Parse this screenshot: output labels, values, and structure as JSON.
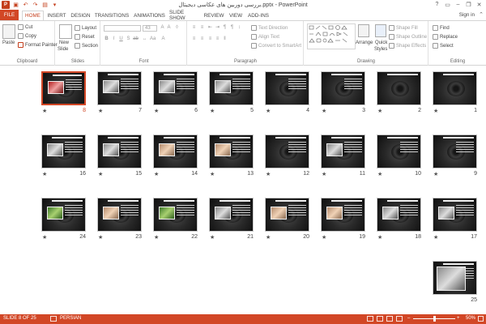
{
  "titlebar": {
    "title": "بررسی دوربین های عکاسی دیجیتال.pptx - PowerPoint",
    "app_icon": "P",
    "qat": [
      {
        "name": "save-icon",
        "glyph": "▣"
      },
      {
        "name": "undo-icon",
        "glyph": "↶"
      },
      {
        "name": "redo-icon",
        "glyph": "↷"
      },
      {
        "name": "start-slideshow-icon",
        "glyph": "▤"
      },
      {
        "name": "customize-qat-icon",
        "glyph": "▾"
      }
    ],
    "window_controls": [
      {
        "name": "help-icon",
        "glyph": "?"
      },
      {
        "name": "ribbon-display-icon",
        "glyph": "▭"
      },
      {
        "name": "minimize-icon",
        "glyph": "–"
      },
      {
        "name": "restore-icon",
        "glyph": "❐"
      },
      {
        "name": "close-icon",
        "glyph": "✕"
      }
    ]
  },
  "tabs": [
    "FILE",
    "HOME",
    "INSERT",
    "DESIGN",
    "TRANSITIONS",
    "ANIMATIONS",
    "SLIDE SHOW",
    "REVIEW",
    "VIEW",
    "ADD-INS"
  ],
  "active_tab": "HOME",
  "signin": "Sign in",
  "ribbon": {
    "clipboard": {
      "label": "Clipboard",
      "paste": "Paste",
      "cut": "Cut",
      "copy": "Copy",
      "format_painter": "Format Painter"
    },
    "slides": {
      "label": "Slides",
      "new_slide": "New",
      "new_slide_2": "Slide",
      "layout": "Layout",
      "reset": "Reset",
      "section": "Section"
    },
    "font": {
      "label": "Font",
      "font_size": "43"
    },
    "paragraph": {
      "label": "Paragraph",
      "text_direction": "Text Direction",
      "align_text": "Align Text",
      "convert_smartart": "Convert to SmartArt"
    },
    "drawing": {
      "label": "Drawing",
      "arrange": "Arrange",
      "quick_styles": "Quick",
      "quick_styles_2": "Styles",
      "shape_fill": "Shape Fill",
      "shape_outline": "Shape Outline",
      "shape_effects": "Shape Effects"
    },
    "editing": {
      "label": "Editing",
      "find": "Find",
      "replace": "Replace",
      "select": "Select"
    }
  },
  "slides": [
    {
      "number": "1",
      "style": "title"
    },
    {
      "number": "2",
      "style": "title"
    },
    {
      "number": "3",
      "style": "text"
    },
    {
      "number": "4",
      "style": "text"
    },
    {
      "number": "5",
      "style": "camera-pic"
    },
    {
      "number": "6",
      "style": "camera-pic"
    },
    {
      "number": "7",
      "style": "camera-pic"
    },
    {
      "number": "8",
      "style": "red-pic"
    },
    {
      "number": "9",
      "style": "text"
    },
    {
      "number": "10",
      "style": "text"
    },
    {
      "number": "11",
      "style": "camera-pic"
    },
    {
      "number": "12",
      "style": "text"
    },
    {
      "number": "13",
      "style": "people-pic"
    },
    {
      "number": "14",
      "style": "people-pic"
    },
    {
      "number": "15",
      "style": "camera-pic"
    },
    {
      "number": "16",
      "style": "camera-pic"
    },
    {
      "number": "17",
      "style": "camera-pic"
    },
    {
      "number": "18",
      "style": "camera-pic"
    },
    {
      "number": "19",
      "style": "people-pic"
    },
    {
      "number": "20",
      "style": "people-pic"
    },
    {
      "number": "21",
      "style": "camera-pic"
    },
    {
      "number": "22",
      "style": "green-pic"
    },
    {
      "number": "23",
      "style": "people-pic"
    },
    {
      "number": "24",
      "style": "green-pic"
    },
    {
      "number": "25",
      "style": "laptop"
    }
  ],
  "selected_slide": "8",
  "transition_marker": "★",
  "status": {
    "slide_info": "SLIDE 8 OF 25",
    "language": "PERSIAN",
    "zoom": "50%",
    "zoom_out": "–",
    "zoom_in": "+"
  },
  "colors": {
    "accent": "#d24726",
    "ribbon_border": "#d4d4d4"
  }
}
